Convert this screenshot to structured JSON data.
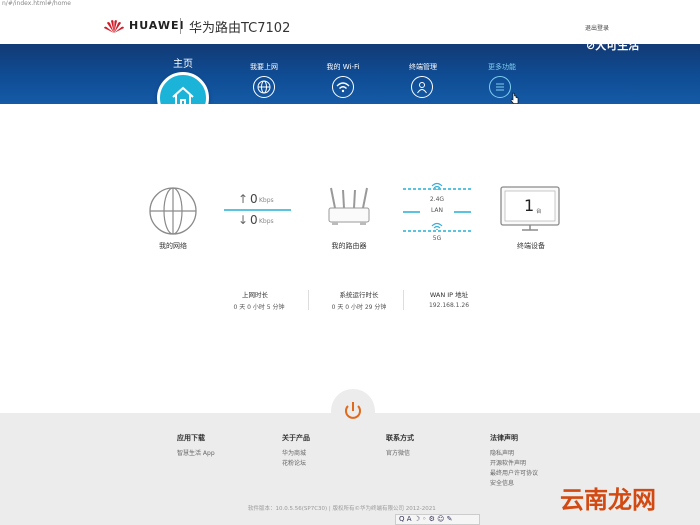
{
  "browser": {
    "url": "n/#/index.html#/home"
  },
  "header": {
    "brand": "HUAWEI",
    "model": "华为路由TC7102",
    "logout": "退出登录"
  },
  "watermark_top": "⊘大可生活",
  "nav": {
    "home": "主页",
    "items": [
      {
        "label": "我要上网"
      },
      {
        "label": "我的 Wi-Fi"
      },
      {
        "label": "终端管理"
      },
      {
        "label": "更多功能"
      }
    ]
  },
  "status": {
    "internet": "我的网络",
    "upload": "0",
    "download": "0",
    "unit": "Kbps",
    "router": "我的路由器",
    "band_24": "2.4G",
    "lan": "LAN",
    "band_5": "5G",
    "devices_count": "1",
    "devices_unit": "台",
    "devices": "终端设备"
  },
  "stats": [
    {
      "label": "上网时长",
      "value": "0 天 0 小时 5 分钟"
    },
    {
      "label": "系统运行时长",
      "value": "0 天 0 小时 29 分钟"
    },
    {
      "label": "WAN IP 地址",
      "value": "192.168.1.26"
    }
  ],
  "footer": {
    "columns": [
      {
        "title": "应用下载",
        "links": [
          "智慧生活 App"
        ]
      },
      {
        "title": "关于产品",
        "links": [
          "华为商城",
          "花粉论坛"
        ]
      },
      {
        "title": "联系方式",
        "links": [
          "官方微信"
        ]
      },
      {
        "title": "法律声明",
        "links": [
          "隐私声明",
          "开源软件声明",
          "最终用户许可协议",
          "安全信息"
        ]
      }
    ],
    "copyright": "软件版本：10.0.5.56(SP7C30)  |  版权所有©华为终端有限公司 2012-2021",
    "taskbar": "Q A ☽ ◦ ⚙ ☺ ✎"
  },
  "watermark_bottom": "云南龙网",
  "colors": {
    "nav": "#0f4d95",
    "accent": "#1bb3d8",
    "power": "#e06a1c"
  }
}
